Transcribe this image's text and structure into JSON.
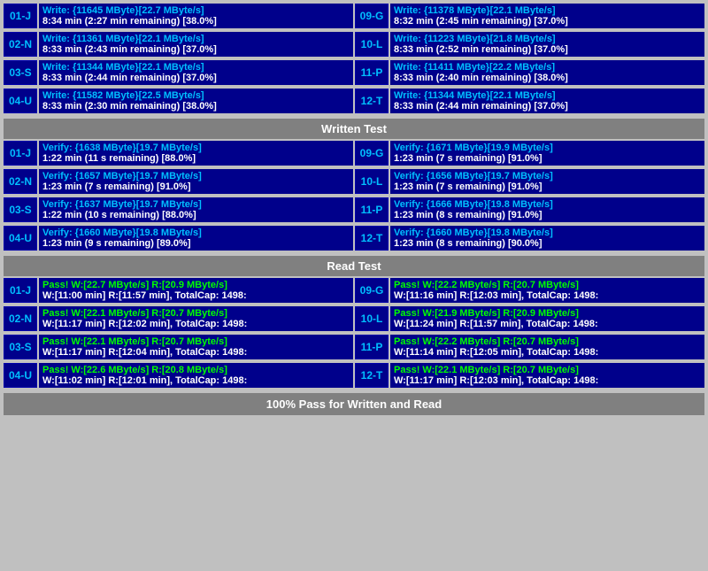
{
  "sections": {
    "write": {
      "rows_left": [
        {
          "id": "01-J",
          "line1": "Write: {11645 MByte}[22.7 MByte/s]",
          "line2": "8:34 min (2:27 min remaining)  [38.0%]"
        },
        {
          "id": "02-N",
          "line1": "Write: {11361 MByte}[22.1 MByte/s]",
          "line2": "8:33 min (2:43 min remaining)  [37.0%]"
        },
        {
          "id": "03-S",
          "line1": "Write: {11344 MByte}[22.1 MByte/s]",
          "line2": "8:33 min (2:44 min remaining)  [37.0%]"
        },
        {
          "id": "04-U",
          "line1": "Write: {11582 MByte}[22.5 MByte/s]",
          "line2": "8:33 min (2:30 min remaining)  [38.0%]"
        }
      ],
      "rows_right": [
        {
          "id": "09-G",
          "line1": "Write: {11378 MByte}[22.1 MByte/s]",
          "line2": "8:32 min (2:45 min remaining)  [37.0%]"
        },
        {
          "id": "10-L",
          "line1": "Write: {11223 MByte}[21.8 MByte/s]",
          "line2": "8:33 min (2:52 min remaining)  [37.0%]"
        },
        {
          "id": "11-P",
          "line1": "Write: {11411 MByte}[22.2 MByte/s]",
          "line2": "8:33 min (2:40 min remaining)  [38.0%]"
        },
        {
          "id": "12-T",
          "line1": "Write: {11344 MByte}[22.1 MByte/s]",
          "line2": "8:33 min (2:44 min remaining)  [37.0%]"
        }
      ],
      "header": "Written Test"
    },
    "verify": {
      "rows_left": [
        {
          "id": "01-J",
          "line1": "Verify: {1638 MByte}[19.7 MByte/s]",
          "line2": "1:22 min (11 s remaining)   [88.0%]"
        },
        {
          "id": "02-N",
          "line1": "Verify: {1657 MByte}[19.7 MByte/s]",
          "line2": "1:23 min (7 s remaining)   [91.0%]"
        },
        {
          "id": "03-S",
          "line1": "Verify: {1637 MByte}[19.7 MByte/s]",
          "line2": "1:22 min (10 s remaining)   [88.0%]"
        },
        {
          "id": "04-U",
          "line1": "Verify: {1660 MByte}[19.8 MByte/s]",
          "line2": "1:23 min (9 s remaining)   [89.0%]"
        }
      ],
      "rows_right": [
        {
          "id": "09-G",
          "line1": "Verify: {1671 MByte}[19.9 MByte/s]",
          "line2": "1:23 min (7 s remaining)   [91.0%]"
        },
        {
          "id": "10-L",
          "line1": "Verify: {1656 MByte}[19.7 MByte/s]",
          "line2": "1:23 min (7 s remaining)   [91.0%]"
        },
        {
          "id": "11-P",
          "line1": "Verify: {1666 MByte}[19.8 MByte/s]",
          "line2": "1:23 min (8 s remaining)   [91.0%]"
        },
        {
          "id": "12-T",
          "line1": "Verify: {1660 MByte}[19.8 MByte/s]",
          "line2": "1:23 min (8 s remaining)   [90.0%]"
        }
      ],
      "header": "Read Test"
    },
    "read": {
      "rows_left": [
        {
          "id": "01-J",
          "line1": "Pass! W:[22.7 MByte/s] R:[20.9 MByte/s]",
          "line2": "W:[11:00 min] R:[11:57 min], TotalCap: 1498:"
        },
        {
          "id": "02-N",
          "line1": "Pass! W:[22.1 MByte/s] R:[20.7 MByte/s]",
          "line2": "W:[11:17 min] R:[12:02 min], TotalCap: 1498:"
        },
        {
          "id": "03-S",
          "line1": "Pass! W:[22.1 MByte/s] R:[20.7 MByte/s]",
          "line2": "W:[11:17 min] R:[12:04 min], TotalCap: 1498:"
        },
        {
          "id": "04-U",
          "line1": "Pass! W:[22.6 MByte/s] R:[20.8 MByte/s]",
          "line2": "W:[11:02 min] R:[12:01 min], TotalCap: 1498:"
        }
      ],
      "rows_right": [
        {
          "id": "09-G",
          "line1": "Pass! W:[22.2 MByte/s] R:[20.7 MByte/s]",
          "line2": "W:[11:16 min] R:[12:03 min], TotalCap: 1498:"
        },
        {
          "id": "10-L",
          "line1": "Pass! W:[21.9 MByte/s] R:[20.9 MByte/s]",
          "line2": "W:[11:24 min] R:[11:57 min], TotalCap: 1498:"
        },
        {
          "id": "11-P",
          "line1": "Pass! W:[22.2 MByte/s] R:[20.7 MByte/s]",
          "line2": "W:[11:14 min] R:[12:05 min], TotalCap: 1498:"
        },
        {
          "id": "12-T",
          "line1": "Pass! W:[22.1 MByte/s] R:[20.7 MByte/s]",
          "line2": "W:[11:17 min] R:[12:03 min], TotalCap: 1498:"
        }
      ]
    },
    "footer": "100% Pass for Written and Read"
  }
}
